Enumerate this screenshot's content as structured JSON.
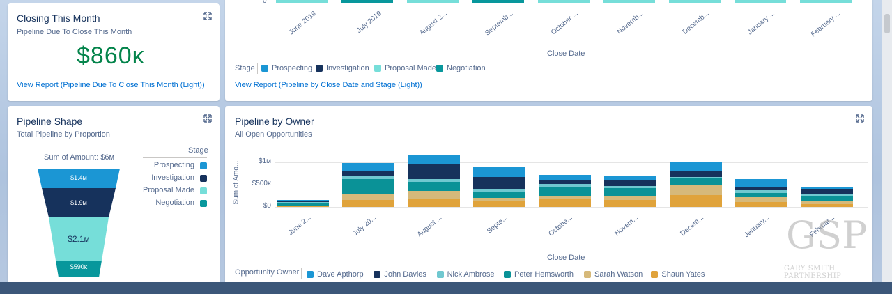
{
  "closing": {
    "title": "Closing This Month",
    "subtitle": "Pipeline Due To Close This Month",
    "value": "$860ᴋ",
    "link": "View Report (Pipeline Due To Close This Month (Light))"
  },
  "top_chart": {
    "xlabel": "Close Date",
    "tick_zero": "0",
    "months": [
      "June 2019",
      "July 2019",
      "August 2...",
      "Septemb...",
      "October ...",
      "Novemb...",
      "Decemb...",
      "January ...",
      "February ..."
    ],
    "legend_title": "Stage",
    "legend": [
      "Prospecting",
      "Investigation",
      "Proposal Made",
      "Negotiation"
    ],
    "link": "View Report (Pipeline by Close Date and Stage (Light))"
  },
  "shape": {
    "title": "Pipeline Shape",
    "subtitle": "Total Pipeline by Proportion",
    "sum_label": "Sum of Amount: $6ᴍ",
    "legend_title": "Stage",
    "stages": [
      {
        "name": "Prospecting",
        "value_label": "$1.4ᴍ",
        "color": "#1b96d4"
      },
      {
        "name": "Investigation",
        "value_label": "$1.9ᴍ",
        "color": "#16325c"
      },
      {
        "name": "Proposal Made",
        "value_label": "$2.1ᴍ",
        "color": "#76ded9"
      },
      {
        "name": "Negotiation",
        "value_label": "$590ᴋ",
        "color": "#08979c"
      }
    ]
  },
  "owner": {
    "title": "Pipeline by Owner",
    "subtitle": "All Open Opportunities",
    "legend_title": "Opportunity Owner",
    "owners": [
      {
        "name": "Dave Apthorp",
        "color": "#1b96d4"
      },
      {
        "name": "John Davies",
        "color": "#16325c"
      },
      {
        "name": "Nick Ambrose",
        "color": "#70c8d0"
      },
      {
        "name": "Peter Hemsworth",
        "color": "#0a9297"
      },
      {
        "name": "Sarah Watson",
        "color": "#d6b97a"
      },
      {
        "name": "Shaun Yates",
        "color": "#e0a33b"
      }
    ]
  },
  "chart_data": {
    "type": "bar",
    "stacked": true,
    "title": "Pipeline by Owner",
    "xlabel": "Close Date",
    "ylabel": "Sum of Amo...",
    "yticks": [
      "$1ᴍ",
      "$500ᴋ",
      "$0"
    ],
    "ylim": [
      0,
      1050000
    ],
    "categories": [
      "June 2...",
      "July 20...",
      "August ...",
      "Septe...",
      "Octobe...",
      "Novem...",
      "Decem...",
      "January...",
      "Februar..."
    ],
    "series": [
      {
        "name": "Dave Apthorp",
        "values": [
          25000,
          180000,
          200000,
          230000,
          120000,
          100000,
          210000,
          170000,
          70000
        ]
      },
      {
        "name": "John Davies",
        "values": [
          30000,
          120000,
          340000,
          260000,
          90000,
          130000,
          140000,
          80000,
          90000
        ]
      },
      {
        "name": "Nick Ambrose",
        "values": [
          25000,
          60000,
          50000,
          60000,
          60000,
          40000,
          30000,
          50000,
          50000
        ]
      },
      {
        "name": "Peter Hemsworth",
        "values": [
          45000,
          330000,
          210000,
          150000,
          210000,
          200000,
          150000,
          100000,
          110000
        ]
      },
      {
        "name": "Sarah Watson",
        "values": [
          20000,
          140000,
          190000,
          80000,
          60000,
          70000,
          230000,
          110000,
          80000
        ]
      },
      {
        "name": "Shaun Yates",
        "values": [
          15000,
          160000,
          170000,
          120000,
          180000,
          160000,
          260000,
          110000,
          60000
        ]
      }
    ],
    "legend_position": "bottom"
  },
  "watermark": {
    "logo": "GSP",
    "caption": "GARY SMITH PARTNERSHIP"
  }
}
